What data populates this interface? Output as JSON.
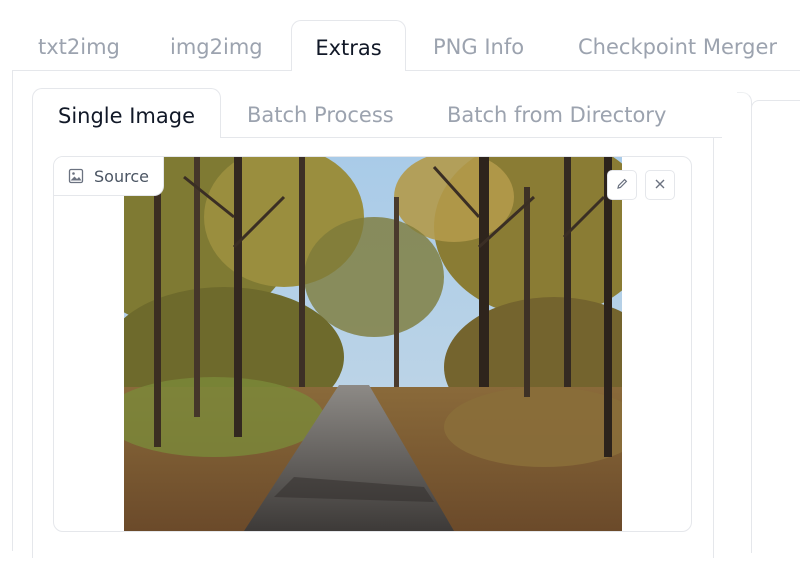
{
  "top_tabs": [
    {
      "label": "txt2img",
      "active": false
    },
    {
      "label": "img2img",
      "active": false
    },
    {
      "label": "Extras",
      "active": true
    },
    {
      "label": "PNG Info",
      "active": false
    },
    {
      "label": "Checkpoint Merger",
      "active": false
    }
  ],
  "sub_tabs": [
    {
      "label": "Single Image",
      "active": true
    },
    {
      "label": "Batch Process",
      "active": false
    },
    {
      "label": "Batch from Directory",
      "active": false
    }
  ],
  "image_input": {
    "label": "Source",
    "label_icon": "image-icon",
    "content": "forest-path-photo",
    "buttons": [
      {
        "name": "edit",
        "icon": "pencil-icon"
      },
      {
        "name": "clear",
        "icon": "close-icon"
      }
    ]
  },
  "colors": {
    "active_text": "#111827",
    "inactive_text": "#9ca3af",
    "border": "#e5e7eb"
  }
}
